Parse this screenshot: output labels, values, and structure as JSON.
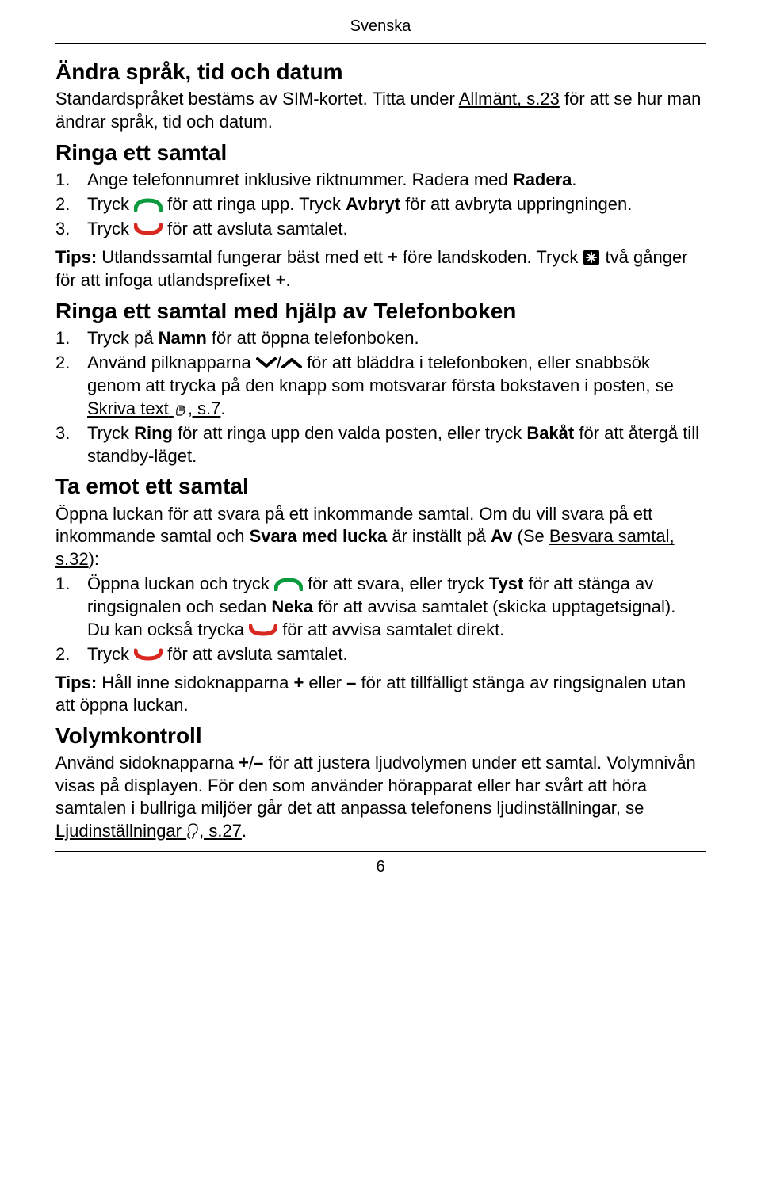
{
  "header": "Svenska",
  "page_number": "6",
  "sec1": {
    "title": "Ändra språk, tid och datum",
    "p1a": "Standardspråket bestäms av SIM-kortet. Titta under ",
    "p1_link": "Allmänt, s.23",
    "p1b": " för att se hur man ändrar språk, tid och datum."
  },
  "sec2": {
    "title": "Ringa ett samtal",
    "li1": "Ange telefonnumret inklusive riktnummer. Radera med ",
    "li1b": "Radera",
    "li1c": ".",
    "li2a": "Tryck ",
    "li2b": " för att ringa upp. Tryck ",
    "li2c": "Avbryt",
    "li2d": " för att avbryta uppringningen.",
    "li3a": "Tryck ",
    "li3b": " för att avsluta samtalet.",
    "tipa": "Tips:",
    "tipb": " Utlandssamtal fungerar bäst med ett ",
    "tipc": "+",
    "tipd": " före landskoden. Tryck ",
    "tipe": " två gånger för att infoga utlandsprefixet ",
    "tipf": "+",
    "tipg": "."
  },
  "sec3": {
    "title": "Ringa ett samtal med hjälp av Telefonboken",
    "li1a": "Tryck på ",
    "li1b": "Namn",
    "li1c": " för att öppna telefonboken.",
    "li2a": "Använd pilknapparna ",
    "li2b": "/",
    "li2c": " för att bläddra i telefonboken, eller snabbsök genom att trycka på den knapp som motsvarar första bokstaven i posten, se ",
    "li2d": "Skriva text",
    "li2e": ", s.7",
    "li2f": ".",
    "li3a": "Tryck ",
    "li3b": "Ring",
    "li3c": " för att ringa upp den valda posten, eller tryck ",
    "li3d": "Bakåt",
    "li3e": " för att återgå till standby-läget."
  },
  "sec4": {
    "title": "Ta emot ett samtal",
    "p1a": "Öppna luckan för att svara på ett inkommande samtal. Om du vill svara på ett inkommande samtal och ",
    "p1b": "Svara med lucka",
    "p1c": " är inställt på ",
    "p1d": "Av",
    "p1e": " (Se ",
    "p1f": "Besvara samtal, s.32",
    "p1g": "):",
    "li1a": "Öppna luckan och tryck ",
    "li1b": " för att svara, eller tryck ",
    "li1c": "Tyst",
    "li1d": " för att stänga av ringsignalen och sedan ",
    "li1e": "Neka",
    "li1f": " för att avvisa samtalet (skicka upptagetsignal).",
    "li1g": "Du kan också trycka ",
    "li1h": " för att avvisa samtalet direkt.",
    "li2a": "Tryck ",
    "li2b": " för att avsluta samtalet.",
    "tipa": "Tips:",
    "tipb": " Håll inne sidoknapparna ",
    "tipc": "+",
    "tipd": " eller ",
    "tipe": "–",
    "tipf": " för att tillfälligt stänga av ringsignalen utan att öppna luckan."
  },
  "sec5": {
    "title": "Volymkontroll",
    "p1a": "Använd sidoknapparna ",
    "p1b": "+",
    "p1c": "/",
    "p1d": "–",
    "p1e": " för att justera ljudvolymen under ett samtal. Volymnivån visas på displayen. För den som använder hörapparat eller har svårt att höra samtalen i bullriga miljöer går det att anpassa telefonens ljudinställningar, se ",
    "p1f": "Ljudinställningar",
    "p1g": ", s.27",
    "p1h": "."
  }
}
